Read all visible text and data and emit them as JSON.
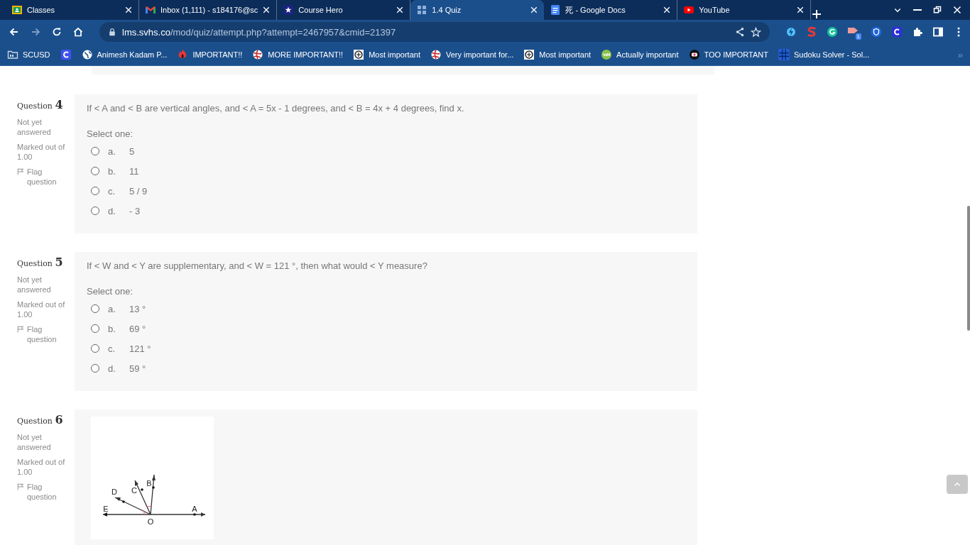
{
  "tabs": [
    {
      "kind": "classroom",
      "title": "Classes",
      "selected": false
    },
    {
      "kind": "gmail",
      "title": "Inbox (1,111) - s184176@sc",
      "selected": false
    },
    {
      "kind": "star",
      "title": "Course Hero",
      "selected": false
    },
    {
      "kind": "grid",
      "title": "1.4 Quiz",
      "selected": true
    },
    {
      "kind": "docs",
      "title": "死 - Google Docs",
      "selected": false
    },
    {
      "kind": "youtube",
      "title": "YouTube",
      "selected": false
    }
  ],
  "nav": [
    {
      "kind": "back",
      "disabled": false
    },
    {
      "kind": "forward",
      "disabled": true
    },
    {
      "kind": "reload",
      "disabled": false
    },
    {
      "kind": "home",
      "disabled": false
    }
  ],
  "address": {
    "host": "lms.svhs.co",
    "path": "/mod/quiz/attempt.php?attempt=2467957&cmid=21397"
  },
  "extensions": [
    {
      "kind": "bolt"
    },
    {
      "kind": "s"
    },
    {
      "kind": "g"
    },
    {
      "kind": "badge",
      "badge": "1"
    },
    {
      "kind": "shield"
    },
    {
      "kind": "c"
    }
  ],
  "bookmarks": [
    {
      "kind": "folder",
      "title": "SCUSD"
    },
    {
      "kind": "c"
    },
    {
      "kind": "globe",
      "title": "Animesh Kadam P..."
    },
    {
      "kind": "flame",
      "title": "IMPORTANT!!"
    },
    {
      "kind": "ball",
      "title": "MORE IMPORTANT!!"
    },
    {
      "kind": "square",
      "title": "Most important"
    },
    {
      "kind": "ball",
      "title": "Very important for..."
    },
    {
      "kind": "square",
      "title": "Most important"
    },
    {
      "kind": "wh",
      "title": "Actually important"
    },
    {
      "kind": "tv",
      "title": "TOO IMPORTANT"
    },
    {
      "kind": "sudoku",
      "title": "Sudoku Solver - Sol..."
    }
  ],
  "bookmarks_more": "»",
  "questions": [
    {
      "label": "Question",
      "number": "4",
      "status": "Not yet answered",
      "marked": "Marked out of 1.00",
      "flag": "Flag question",
      "text": "If < A and < B are vertical angles, and < A = 5x - 1 degrees, and < B = 4x + 4 degrees, find x.",
      "prompt": "Select one:",
      "options": [
        {
          "letter": "a.",
          "text": "5",
          "selected": false
        },
        {
          "letter": "b.",
          "text": "11",
          "selected": false
        },
        {
          "letter": "c.",
          "text": "5 / 9",
          "selected": false
        },
        {
          "letter": "d.",
          "text": "- 3",
          "selected": false
        }
      ]
    },
    {
      "label": "Question",
      "number": "5",
      "status": "Not yet answered",
      "marked": "Marked out of 1.00",
      "flag": "Flag question",
      "text": "If < W and < Y are supplementary, and < W = 121 °, then what would < Y measure?",
      "prompt": "Select one:",
      "options": [
        {
          "letter": "a.",
          "text": "13 °",
          "selected": false
        },
        {
          "letter": "b.",
          "text": "69 °",
          "selected": false
        },
        {
          "letter": "c.",
          "text": "121 °",
          "selected": false
        },
        {
          "letter": "d.",
          "text": "59 °",
          "selected": false
        }
      ]
    },
    {
      "label": "Question",
      "number": "6",
      "status": "Not yet answered",
      "marked": "Marked out of 1.00",
      "flag": "Flag question",
      "figure": {
        "labels": [
          "A",
          "B",
          "C",
          "D",
          "E",
          "O"
        ]
      }
    }
  ]
}
